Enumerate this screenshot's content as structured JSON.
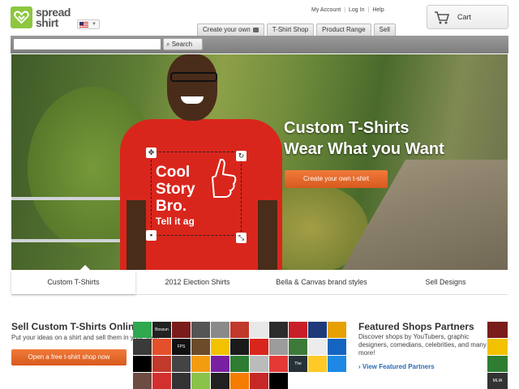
{
  "header": {
    "logo_line1": "spread",
    "logo_line2": "shirt",
    "top_links": [
      "My Account",
      "Log In",
      "Help"
    ],
    "nav_tabs": [
      "Create your own",
      "T-Shirt Shop",
      "Product Range",
      "Sell"
    ],
    "cart_label": "Cart"
  },
  "search": {
    "value": "",
    "placeholder": "",
    "button_label": "Search"
  },
  "hero": {
    "headline_line1": "Custom T-Shirts",
    "headline_line2": "Wear What you Want",
    "cta_label": "Create your own t-shirt",
    "shirt_print_lines": [
      "Cool",
      "Story",
      "Bro."
    ],
    "shirt_print_small": "Tell it ag"
  },
  "category_tabs": [
    {
      "label": "Custom T-Shirts",
      "active": true
    },
    {
      "label": "2012 Election Shirts",
      "active": false
    },
    {
      "label": "Bella & Canvas brand styles",
      "active": false
    },
    {
      "label": "Sell Designs",
      "active": false
    }
  ],
  "sell_section": {
    "title": "Sell Custom T-Shirts Online",
    "text": "Put your ideas on a shirt and sell them in your shop!",
    "button_label": "Open a free t-shirt shop now"
  },
  "featured": {
    "title": "Featured Shops Partners",
    "text": "Discover shops by YouTubers, graphic designers, comedians, celebrities, and many more!",
    "link_label": "View Featured Partners"
  },
  "mosaic_tiles": [
    {
      "color": "#2fa84f",
      "label": ""
    },
    {
      "color": "#222222",
      "label": "Bossun"
    },
    {
      "color": "#7a1c1c",
      "label": ""
    },
    {
      "color": "#555555",
      "label": ""
    },
    {
      "color": "#8a8a8a",
      "label": ""
    },
    {
      "color": "#c0392b",
      "label": ""
    },
    {
      "color": "#e8e8e8",
      "label": ""
    },
    {
      "color": "#2c2c2c",
      "label": ""
    },
    {
      "color": "#c81e28",
      "label": ""
    },
    {
      "color": "#1f3a78",
      "label": ""
    },
    {
      "color": "#e6a100",
      "label": ""
    },
    {
      "color": "#3a3a3a",
      "label": ""
    },
    {
      "color": "#e3502a",
      "label": ""
    },
    {
      "color": "#111111",
      "label": "FPS"
    },
    {
      "color": "#6b4b2a",
      "label": ""
    },
    {
      "color": "#f2c200",
      "label": ""
    },
    {
      "color": "#1a1a1a",
      "label": ""
    },
    {
      "color": "#d9261c",
      "label": ""
    },
    {
      "color": "#9c9c9c",
      "label": ""
    },
    {
      "color": "#3d7a3a",
      "label": ""
    },
    {
      "color": "#ececec",
      "label": ""
    },
    {
      "color": "#1565c0",
      "label": ""
    },
    {
      "color": "#000000",
      "label": ""
    },
    {
      "color": "#c0392b",
      "label": ""
    },
    {
      "color": "#444444",
      "label": ""
    },
    {
      "color": "#f39c12",
      "label": ""
    },
    {
      "color": "#7b1fa2",
      "label": ""
    },
    {
      "color": "#2e7d32",
      "label": ""
    },
    {
      "color": "#bbbbbb",
      "label": ""
    },
    {
      "color": "#e53935",
      "label": ""
    },
    {
      "color": "#263238",
      "label": "The Names"
    },
    {
      "color": "#ffca28",
      "label": ""
    },
    {
      "color": "#1e88e5",
      "label": ""
    },
    {
      "color": "#6d4c41",
      "label": ""
    },
    {
      "color": "#d32f2f",
      "label": ""
    },
    {
      "color": "#333333",
      "label": ""
    },
    {
      "color": "#8bc34a",
      "label": ""
    },
    {
      "color": "#212121",
      "label": ""
    },
    {
      "color": "#f57c00",
      "label": ""
    },
    {
      "color": "#c62828",
      "label": ""
    },
    {
      "color": "#000000",
      "label": ""
    }
  ],
  "right_tiles": [
    {
      "color": "#7a1c1c",
      "label": ""
    },
    {
      "color": "#f2c200",
      "label": ""
    },
    {
      "color": "#2e7d32",
      "label": ""
    },
    {
      "color": "#333333",
      "label": "MLIA"
    }
  ],
  "colors": {
    "accent_orange": "#e0662a",
    "brand_green": "#8dc63f",
    "link_blue": "#2a6bb5"
  }
}
